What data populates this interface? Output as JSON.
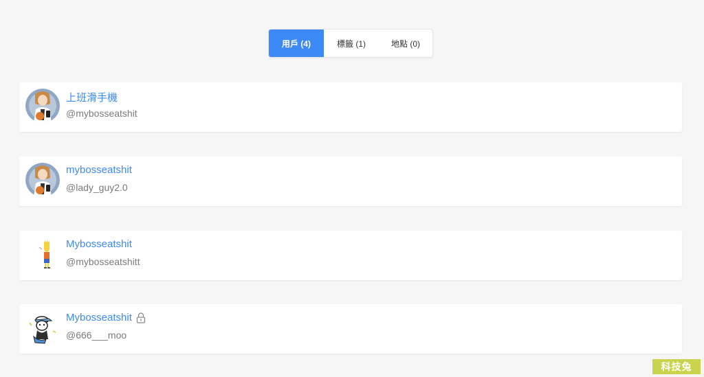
{
  "tabs": [
    {
      "label": "用戶 (4)",
      "active": true
    },
    {
      "label": "標籤 (1)",
      "active": false
    },
    {
      "label": "地點 (0)",
      "active": false
    }
  ],
  "users": [
    {
      "name": "上班滑手機",
      "handle": "@mybosseatshit",
      "avatar_icon": "cartoon-woman-phone-avatar",
      "private": false
    },
    {
      "name": "mybosseatshit",
      "handle": "@lady_guy2.0",
      "avatar_icon": "cartoon-woman-phone-avatar",
      "private": false
    },
    {
      "name": "Mybosseatshit",
      "handle": "@mybosseatshitt",
      "avatar_icon": "cartoon-boy-avatar",
      "private": false
    },
    {
      "name": "Mybosseatshit",
      "handle": "@666___moo",
      "avatar_icon": "cartoon-character-cap-avatar",
      "private": true
    }
  ],
  "watermark": "科技兔",
  "colors": {
    "accent": "#3d8af7",
    "background": "#f6f6f7",
    "card": "#ffffff",
    "muted_text": "#7a7a7a",
    "watermark_bg": "#c9d44c"
  }
}
